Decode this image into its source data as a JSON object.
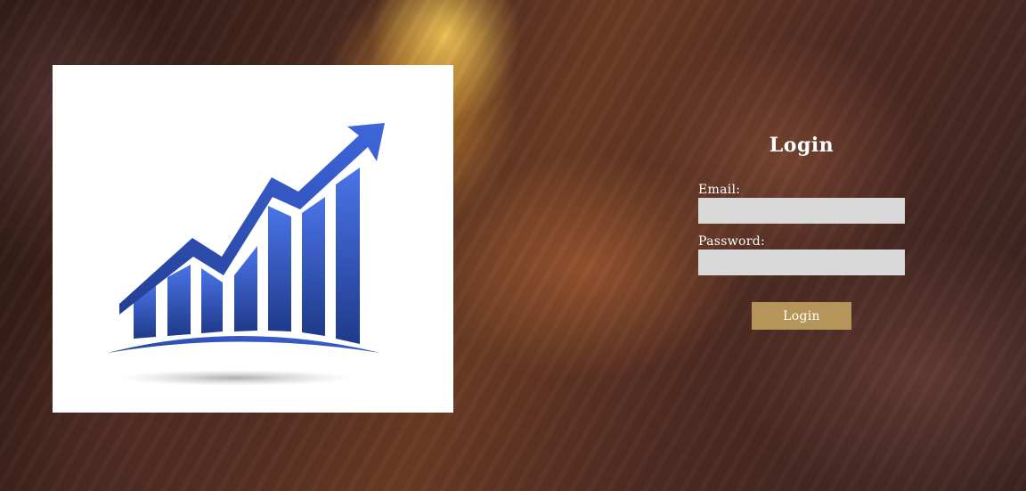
{
  "colors": {
    "button_background": "#b5955a",
    "input_background": "#d9d9d9",
    "text": "#ffffff",
    "logo_blue_light": "#4a74e8",
    "logo_blue_dark": "#1f3a8a"
  },
  "logo": {
    "icon": "growth-chart-icon"
  },
  "login": {
    "title": "Login",
    "email_label": "Email:",
    "email_value": "",
    "password_label": "Password:",
    "password_value": "",
    "submit_label": "Login"
  }
}
